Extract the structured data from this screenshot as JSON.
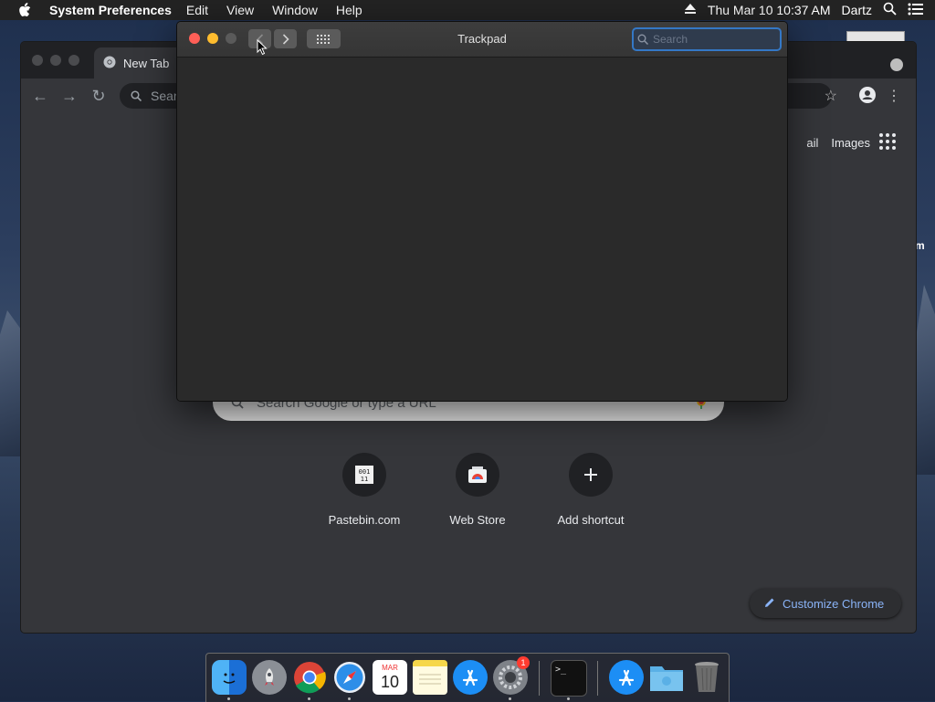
{
  "menubar": {
    "app_name": "System Preferences",
    "items": [
      "Edit",
      "View",
      "Window",
      "Help"
    ],
    "datetime": "Thu Mar 10  10:37 AM",
    "user": "Dartz"
  },
  "desktop": {
    "label": "m"
  },
  "chrome": {
    "tab_title": "New Tab",
    "omnibox_placeholder": "Sear",
    "links": [
      "ail",
      "Images"
    ],
    "search_placeholder": "Search Google or type a URL",
    "shortcuts": [
      {
        "label": "Pastebin.com",
        "icon": "pastebin-icon"
      },
      {
        "label": "Web Store",
        "icon": "webstore-icon"
      },
      {
        "label": "Add shortcut",
        "icon": "plus-icon"
      }
    ],
    "customize_label": "Customize Chrome"
  },
  "prefs": {
    "title": "Trackpad",
    "search_placeholder": "Search"
  },
  "dock": {
    "apps": [
      "Finder",
      "Launchpad",
      "Chrome",
      "Safari",
      "Calendar",
      "Notes",
      "App Store",
      "System Preferences",
      "Terminal",
      "Applications",
      "Downloads",
      "Trash"
    ],
    "calendar_month": "MAR",
    "calendar_day": "10",
    "badge": "1"
  },
  "colors": {
    "close": "#ff5f57",
    "minimize": "#febc2e",
    "accent": "#8ab4f8",
    "focus_ring": "#3478c6"
  }
}
